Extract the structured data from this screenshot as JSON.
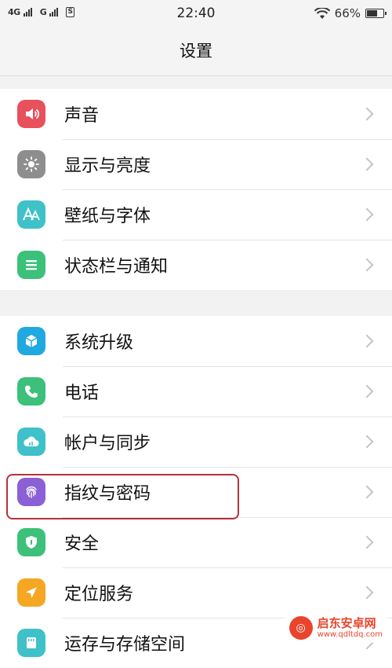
{
  "status_bar": {
    "network_1": "4G",
    "network_2": "G",
    "sim_icon": "S",
    "time": "22:40",
    "battery_percent": "66%",
    "battery_level": 0.66
  },
  "header": {
    "title": "设置"
  },
  "groups": [
    {
      "items": [
        {
          "label": "声音",
          "icon": "speaker-icon",
          "color": "#e8505b"
        },
        {
          "label": "显示与亮度",
          "icon": "sun-icon",
          "color": "#8e8e8e"
        },
        {
          "label": "壁纸与字体",
          "icon": "font-icon",
          "color": "#3ec1c8"
        },
        {
          "label": "状态栏与通知",
          "icon": "list-icon",
          "color": "#3cc07a"
        }
      ]
    },
    {
      "items": [
        {
          "label": "系统升级",
          "icon": "update-cube-icon",
          "color": "#1fa9e0"
        },
        {
          "label": "电话",
          "icon": "phone-icon",
          "color": "#3cc07a"
        },
        {
          "label": "帐户与同步",
          "icon": "cloud-icon",
          "color": "#3ec1c8"
        },
        {
          "label": "指纹与密码",
          "icon": "fingerprint-icon",
          "color": "#8b5fd6"
        },
        {
          "label": "安全",
          "icon": "shield-icon",
          "color": "#3cc07a"
        },
        {
          "label": "定位服务",
          "icon": "location-arrow-icon",
          "color": "#f5a623"
        },
        {
          "label": "运存与存储空间",
          "icon": "storage-icon",
          "color": "#3ec1c8"
        }
      ]
    }
  ],
  "watermark": {
    "name": "启东安卓网",
    "url": "www.qdltdq.com"
  }
}
